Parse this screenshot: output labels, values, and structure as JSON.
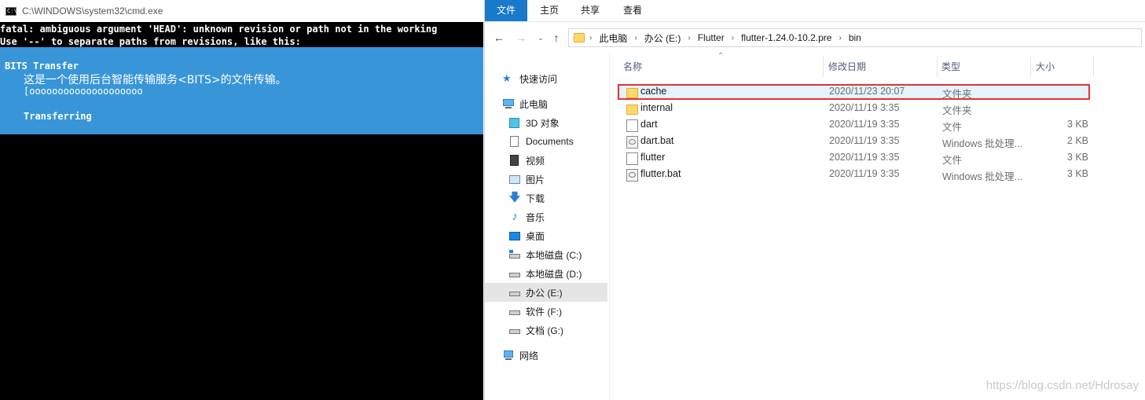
{
  "cmd": {
    "title": "C:\\WINDOWS\\system32\\cmd.exe",
    "lines": [
      "fatal: ambiguous argument 'HEAD': unknown revision or path not in the working",
      "Use '--' to separate paths from revisions, like this:"
    ],
    "bits": {
      "heading": "BITS Transfer",
      "description": "这是一个使用后台智能传输服务<BITS>的文件传输。",
      "progress": "[oooooooooooooooooooo",
      "status": "Transferring"
    },
    "colors": {
      "bits_background": "#3896d8"
    }
  },
  "explorer": {
    "ribbon_tabs": [
      {
        "label": "文件",
        "active": true
      },
      {
        "label": "主页",
        "active": false
      },
      {
        "label": "共享",
        "active": false
      },
      {
        "label": "查看",
        "active": false
      }
    ],
    "breadcrumb": [
      "此电脑",
      "办公 (E:)",
      "Flutter",
      "flutter-1.24.0-10.2.pre",
      "bin"
    ],
    "nav": [
      {
        "label": "快速访问",
        "icon": "star-icon"
      },
      {
        "label": "此电脑",
        "icon": "computer-icon"
      },
      {
        "label": "3D 对象",
        "icon": "cube-icon"
      },
      {
        "label": "Documents",
        "icon": "document-icon"
      },
      {
        "label": "视频",
        "icon": "video-icon"
      },
      {
        "label": "图片",
        "icon": "picture-icon"
      },
      {
        "label": "下载",
        "icon": "download-icon"
      },
      {
        "label": "音乐",
        "icon": "music-icon"
      },
      {
        "label": "桌面",
        "icon": "desktop-icon"
      },
      {
        "label": "本地磁盘 (C:)",
        "icon": "drive-icon"
      },
      {
        "label": "本地磁盘 (D:)",
        "icon": "drive-icon"
      },
      {
        "label": "办公 (E:)",
        "icon": "drive-icon",
        "selected": true
      },
      {
        "label": "软件 (F:)",
        "icon": "drive-icon"
      },
      {
        "label": "文档 (G:)",
        "icon": "drive-icon"
      },
      {
        "label": "网络",
        "icon": "network-icon"
      }
    ],
    "columns": {
      "name": "名称",
      "date": "修改日期",
      "type": "类型",
      "size": "大小"
    },
    "files": [
      {
        "name": "cache",
        "date": "2020/11/23 20:07",
        "type": "文件夹",
        "size": "",
        "icon": "folder-icon",
        "selected": true
      },
      {
        "name": "internal",
        "date": "2020/11/19 3:35",
        "type": "文件夹",
        "size": "",
        "icon": "folder-icon"
      },
      {
        "name": "dart",
        "date": "2020/11/19 3:35",
        "type": "文件",
        "size": "3 KB",
        "icon": "file-icon"
      },
      {
        "name": "dart.bat",
        "date": "2020/11/19 3:35",
        "type": "Windows 批处理...",
        "size": "2 KB",
        "icon": "batch-file-icon"
      },
      {
        "name": "flutter",
        "date": "2020/11/19 3:35",
        "type": "文件",
        "size": "3 KB",
        "icon": "file-icon"
      },
      {
        "name": "flutter.bat",
        "date": "2020/11/19 3:35",
        "type": "Windows 批处理...",
        "size": "3 KB",
        "icon": "batch-file-icon"
      }
    ],
    "colors": {
      "ribbon_active": "#1979ca",
      "highlight_box": "#e53238",
      "selected_row": "#e5f3fb"
    }
  },
  "watermark": "https://blog.csdn.net/Hdrosay"
}
